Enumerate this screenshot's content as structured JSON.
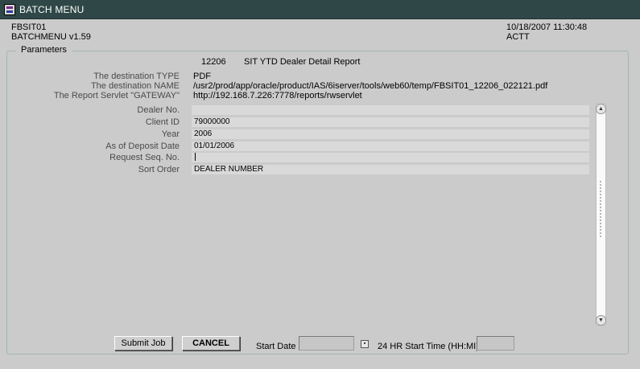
{
  "window": {
    "title": "BATCH MENU",
    "icon": "app-form-icon"
  },
  "header": {
    "form_id": "FBSIT01",
    "version": "BATCHMENU v1.59",
    "datetime": "10/18/2007 11:30:48",
    "user": "ACTT"
  },
  "parameters": {
    "legend": "Parameters",
    "report_number": "12206",
    "report_name": "SIT YTD Dealer Detail Report",
    "destination_type_label": "The destination TYPE",
    "destination_type_value": "PDF",
    "destination_name_label": "The destination NAME",
    "destination_name_value": "/usr2/prod/app/oracle/product/IAS/6iserver/tools/web60/temp/FBSIT01_12206_022121.pdf",
    "servlet_label": "The Report Servlet \"GATEWAY\"",
    "servlet_value": "http://192.168.7.226:7778/reports/rwservlet",
    "fields": [
      {
        "label": "Dealer No.",
        "value": ""
      },
      {
        "label": "Client ID",
        "value": "79000000"
      },
      {
        "label": "Year",
        "value": "2006"
      },
      {
        "label": "As of Deposit Date",
        "value": "01/01/2006"
      },
      {
        "label": "Request Seq. No.",
        "value": ""
      },
      {
        "label": "Sort Order",
        "value": "DEALER NUMBER"
      }
    ]
  },
  "footer": {
    "submit_label": "Submit Job",
    "cancel_label": "CANCEL",
    "start_date_label": "Start Date",
    "start_date_value": "",
    "start_time_label": "24 HR Start Time (HH:MI)",
    "start_time_value": ""
  }
}
